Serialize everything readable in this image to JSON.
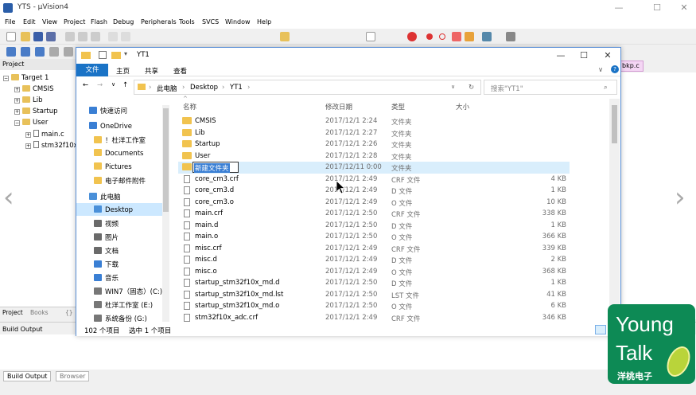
{
  "uvision": {
    "title": "YTS - µVision4",
    "menu": [
      "File",
      "Edit",
      "View",
      "Project",
      "Flash",
      "Debug",
      "Peripherals",
      "Tools",
      "SVCS",
      "Window",
      "Help"
    ],
    "project_pane_title": "Project",
    "tree": [
      {
        "label": "Target 1",
        "level": 0
      },
      {
        "label": "CMSIS",
        "level": 1
      },
      {
        "label": "Lib",
        "level": 1
      },
      {
        "label": "Startup",
        "level": 1
      },
      {
        "label": "User",
        "level": 1
      },
      {
        "label": "main.c",
        "level": 2
      },
      {
        "label": "stm32f10x",
        "level": 2
      }
    ],
    "pane_tabs": [
      "Project",
      "Books",
      "{}"
    ],
    "build_output_title": "Build Output",
    "bottom_tabs": [
      "Build Output",
      "Browser"
    ],
    "editor_tab": "bkp.c"
  },
  "explorer": {
    "window_title": "YT1",
    "ribbon": {
      "file": "文件",
      "home": "主页",
      "share": "共享",
      "view": "查看"
    },
    "address": [
      "此电脑",
      "Desktop",
      "YT1"
    ],
    "search_placeholder": "搜索\"YT1\"",
    "nav": [
      {
        "label": "快速访问",
        "icon": "star-icon",
        "indent": 0
      },
      {
        "label": "OneDrive",
        "icon": "cloud-icon",
        "indent": 0
      },
      {
        "label": "！杜洋工作室",
        "icon": "folder-icon",
        "indent": 1
      },
      {
        "label": "Documents",
        "icon": "folder-icon",
        "indent": 1
      },
      {
        "label": "Pictures",
        "icon": "folder-icon",
        "indent": 1
      },
      {
        "label": "电子邮件附件",
        "icon": "folder-icon",
        "indent": 1
      },
      {
        "label": "此电脑",
        "icon": "computer-icon",
        "indent": 0
      },
      {
        "label": "Desktop",
        "icon": "desktop-icon",
        "indent": 1,
        "selected": true
      },
      {
        "label": "视频",
        "icon": "video-icon",
        "indent": 1
      },
      {
        "label": "图片",
        "icon": "picture-icon",
        "indent": 1
      },
      {
        "label": "文档",
        "icon": "document-icon",
        "indent": 1
      },
      {
        "label": "下载",
        "icon": "download-icon",
        "indent": 1
      },
      {
        "label": "音乐",
        "icon": "music-icon",
        "indent": 1
      },
      {
        "label": "WIN7（固态）(C:)",
        "icon": "drive-icon",
        "indent": 1
      },
      {
        "label": "杜洋工作室 (E:)",
        "icon": "drive-icon",
        "indent": 1
      },
      {
        "label": "系统备份 (G:)",
        "icon": "drive-icon",
        "indent": 1
      }
    ],
    "columns": {
      "name": "名称",
      "date": "修改日期",
      "type": "类型",
      "size": "大小"
    },
    "rows": [
      {
        "name": "CMSIS",
        "date": "2017/12/1 2:24",
        "type": "文件夹",
        "size": "",
        "kind": "folder"
      },
      {
        "name": "Lib",
        "date": "2017/12/1 2:27",
        "type": "文件夹",
        "size": "",
        "kind": "folder"
      },
      {
        "name": "Startup",
        "date": "2017/12/1 2:26",
        "type": "文件夹",
        "size": "",
        "kind": "folder"
      },
      {
        "name": "User",
        "date": "2017/12/1 2:28",
        "type": "文件夹",
        "size": "",
        "kind": "folder"
      },
      {
        "name": "新建文件夹",
        "date": "2017/12/11 0:00",
        "type": "文件夹",
        "size": "",
        "kind": "folder",
        "renaming": true
      },
      {
        "name": "core_cm3.crf",
        "date": "2017/12/1 2:49",
        "type": "CRF 文件",
        "size": "4 KB",
        "kind": "file"
      },
      {
        "name": "core_cm3.d",
        "date": "2017/12/1 2:49",
        "type": "D 文件",
        "size": "1 KB",
        "kind": "file"
      },
      {
        "name": "core_cm3.o",
        "date": "2017/12/1 2:49",
        "type": "O 文件",
        "size": "10 KB",
        "kind": "file"
      },
      {
        "name": "main.crf",
        "date": "2017/12/1 2:50",
        "type": "CRF 文件",
        "size": "338 KB",
        "kind": "file"
      },
      {
        "name": "main.d",
        "date": "2017/12/1 2:50",
        "type": "D 文件",
        "size": "1 KB",
        "kind": "file"
      },
      {
        "name": "main.o",
        "date": "2017/12/1 2:50",
        "type": "O 文件",
        "size": "366 KB",
        "kind": "file"
      },
      {
        "name": "misc.crf",
        "date": "2017/12/1 2:49",
        "type": "CRF 文件",
        "size": "339 KB",
        "kind": "file"
      },
      {
        "name": "misc.d",
        "date": "2017/12/1 2:49",
        "type": "D 文件",
        "size": "2 KB",
        "kind": "file"
      },
      {
        "name": "misc.o",
        "date": "2017/12/1 2:49",
        "type": "O 文件",
        "size": "368 KB",
        "kind": "file"
      },
      {
        "name": "startup_stm32f10x_md.d",
        "date": "2017/12/1 2:50",
        "type": "D 文件",
        "size": "1 KB",
        "kind": "file"
      },
      {
        "name": "startup_stm32f10x_md.lst",
        "date": "2017/12/1 2:50",
        "type": "LST 文件",
        "size": "41 KB",
        "kind": "file"
      },
      {
        "name": "startup_stm32f10x_md.o",
        "date": "2017/12/1 2:50",
        "type": "O 文件",
        "size": "6 KB",
        "kind": "file"
      },
      {
        "name": "stm32f10x_adc.crf",
        "date": "2017/12/1 2:49",
        "type": "CRF 文件",
        "size": "346 KB",
        "kind": "file"
      }
    ],
    "status": {
      "count": "102 个项目",
      "selected": "选中 1 个项目"
    }
  },
  "badge": {
    "line1": "Young",
    "line2": "Talk",
    "line3": "洋桃电子"
  },
  "colors": {
    "accent": "#1a73c6",
    "selection": "#d9eefc",
    "badge": "#0d8a55"
  }
}
